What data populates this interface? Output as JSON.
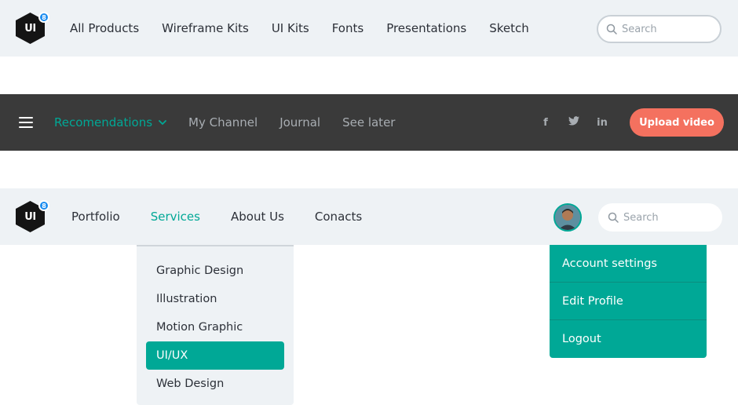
{
  "colors": {
    "accent": "#00a896",
    "dark_bar": "#3a3a3a",
    "light_bar": "#eef2f5",
    "upload": "#f4715f",
    "badge": "#1a8cf0"
  },
  "nav1": {
    "logo": {
      "text": "UI",
      "badge": "8"
    },
    "links": [
      "All Products",
      "Wireframe Kits",
      "UI Kits",
      "Fonts",
      "Presentations",
      "Sketch"
    ],
    "search": {
      "placeholder": "Search",
      "icon": "search-icon"
    }
  },
  "nav2": {
    "menu_icon": "hamburger-icon",
    "links": [
      {
        "label": "Recomendations",
        "active": true,
        "icon": "chevron-down-icon"
      },
      {
        "label": "My Channel",
        "active": false
      },
      {
        "label": "Journal",
        "active": false
      },
      {
        "label": "See later",
        "active": false
      }
    ],
    "socials": [
      {
        "name": "facebook-icon",
        "glyph": "f"
      },
      {
        "name": "twitter-icon",
        "glyph": ""
      },
      {
        "name": "linkedin-icon",
        "glyph": "in"
      }
    ],
    "upload_label": "Upload video"
  },
  "nav3": {
    "logo": {
      "text": "UI",
      "badge": "8"
    },
    "links": [
      {
        "label": "Portfolio",
        "active": false
      },
      {
        "label": "Services",
        "active": true
      },
      {
        "label": "About Us",
        "active": false
      },
      {
        "label": "Conacts",
        "active": false
      }
    ],
    "avatar": "user-avatar",
    "search": {
      "placeholder": "Search",
      "icon": "search-icon"
    }
  },
  "services_menu": {
    "items": [
      "Graphic Design",
      "Illustration",
      "Motion Graphic",
      "UI/UX",
      "Web Design"
    ],
    "selected": "UI/UX"
  },
  "account_menu": {
    "items": [
      "Account settings",
      "Edit Profile",
      "Logout"
    ]
  }
}
